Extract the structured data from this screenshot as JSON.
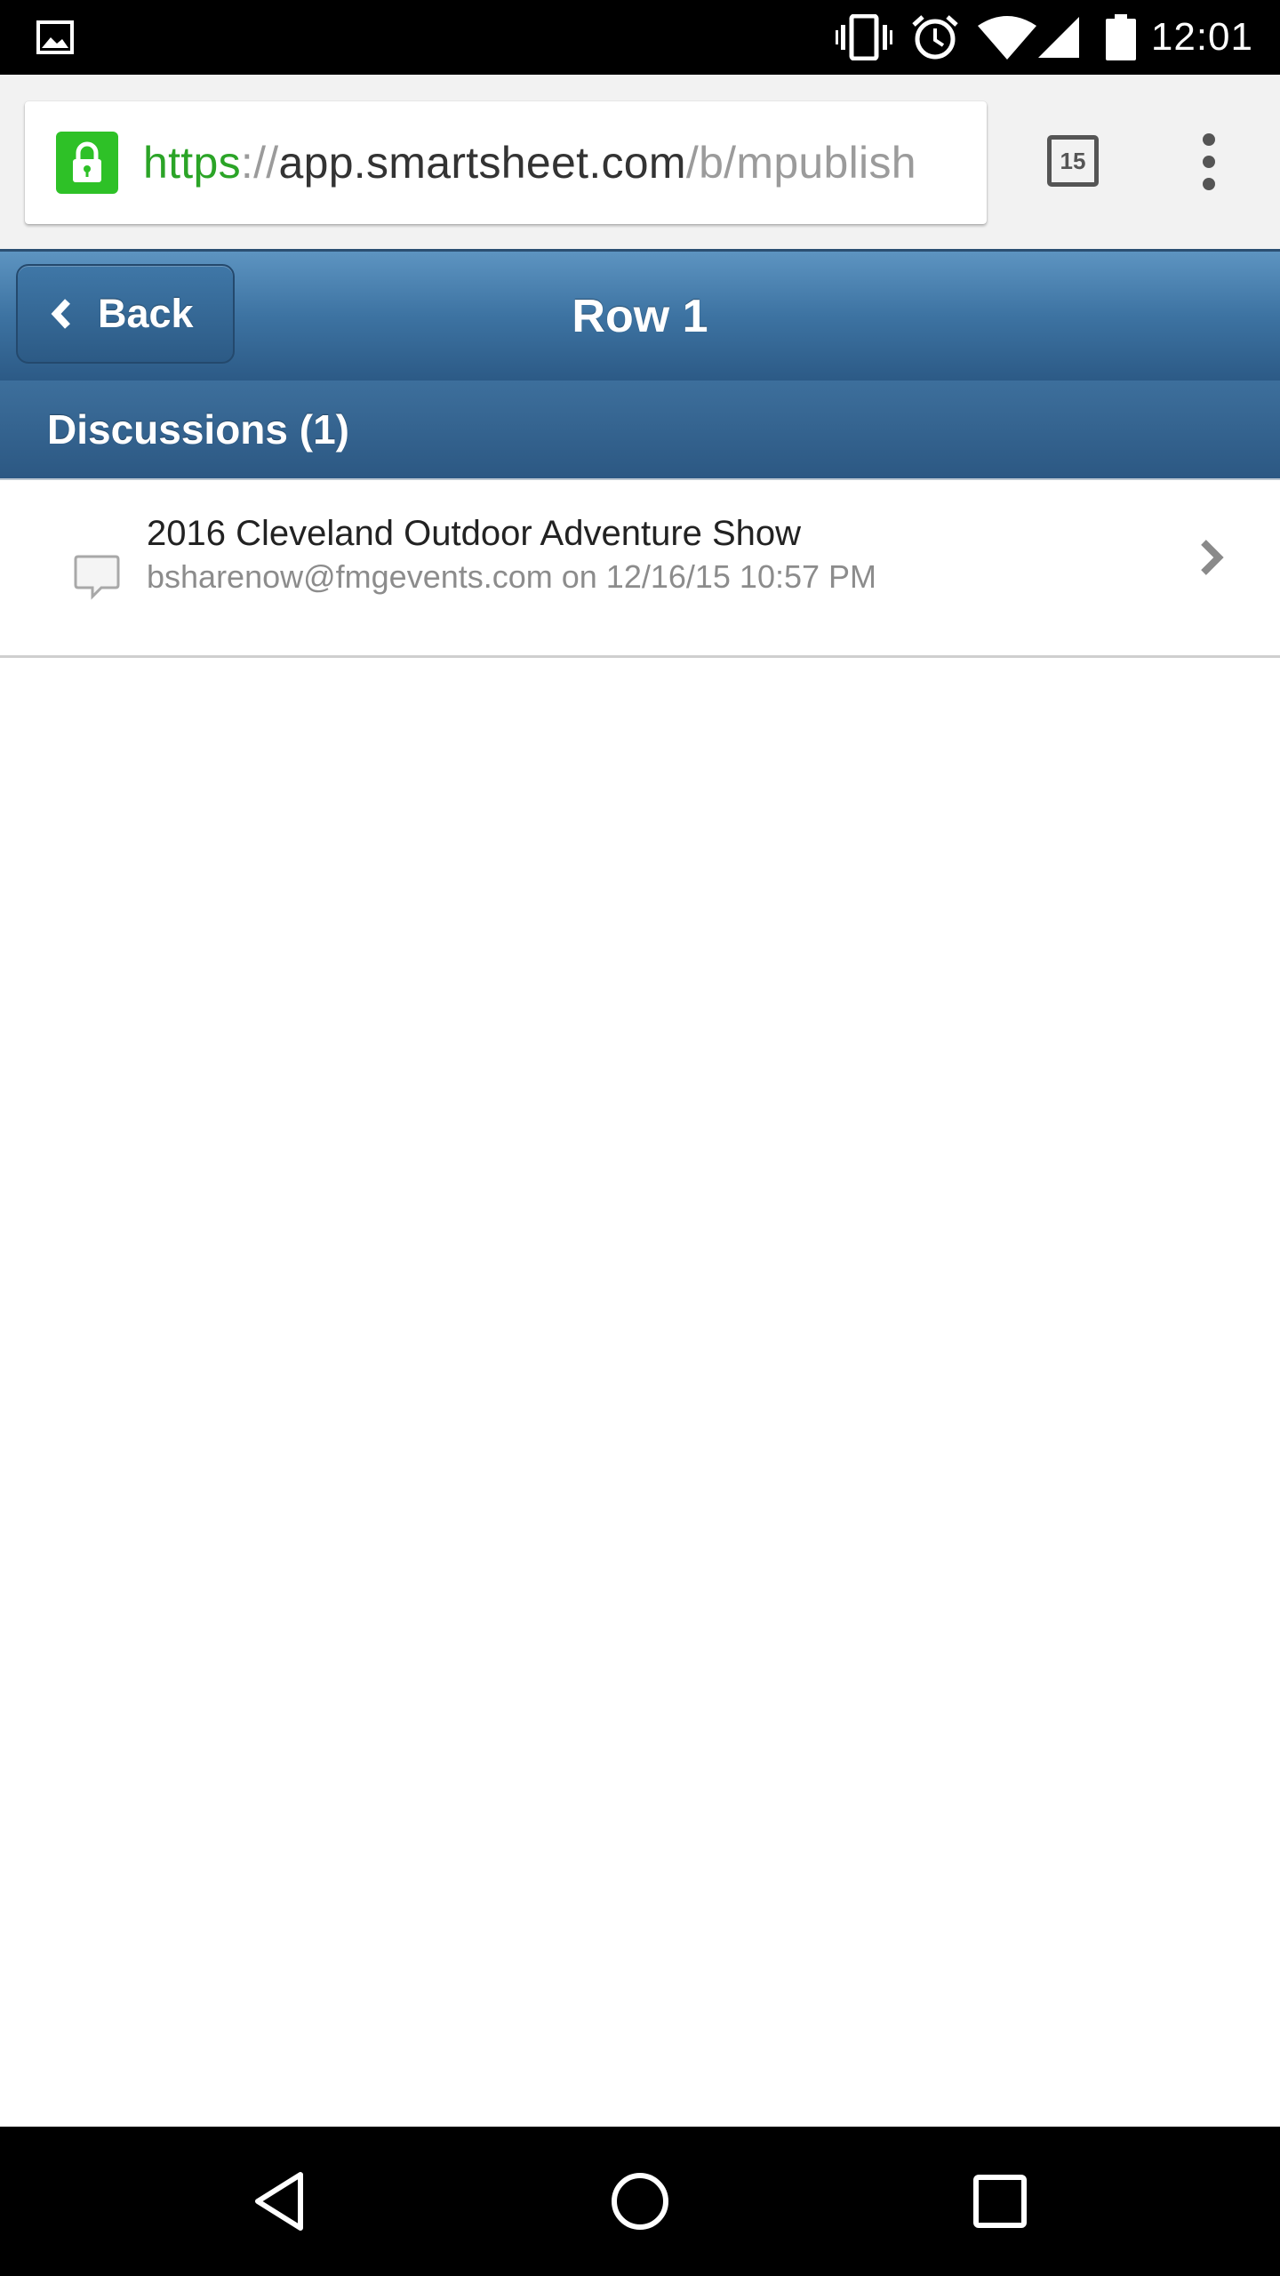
{
  "status_bar": {
    "time": "12:01",
    "icons": [
      "image-notification-icon",
      "vibrate-icon",
      "alarm-icon",
      "wifi-icon",
      "cell-signal-icon",
      "battery-icon"
    ]
  },
  "browser": {
    "url_scheme": "https",
    "url_separator": "://",
    "url_host": "app.smartsheet.com",
    "url_path": "/b/mpublish",
    "tab_count": "15",
    "secure": true,
    "secure_color": "#2ec127"
  },
  "header": {
    "back_label": "Back",
    "title": "Row 1"
  },
  "section": {
    "title": "Discussions (1)"
  },
  "discussions": [
    {
      "title": "2016 Cleveland Outdoor Adventure Show",
      "meta": "bsharenow@fmgevents.com on 12/16/15 10:57 PM"
    }
  ],
  "nav_bar": {
    "buttons": [
      "back-nav-icon",
      "home-nav-icon",
      "recents-nav-icon"
    ]
  },
  "colors": {
    "header_blue": "#3d73a2",
    "section_blue": "#2c5883"
  }
}
